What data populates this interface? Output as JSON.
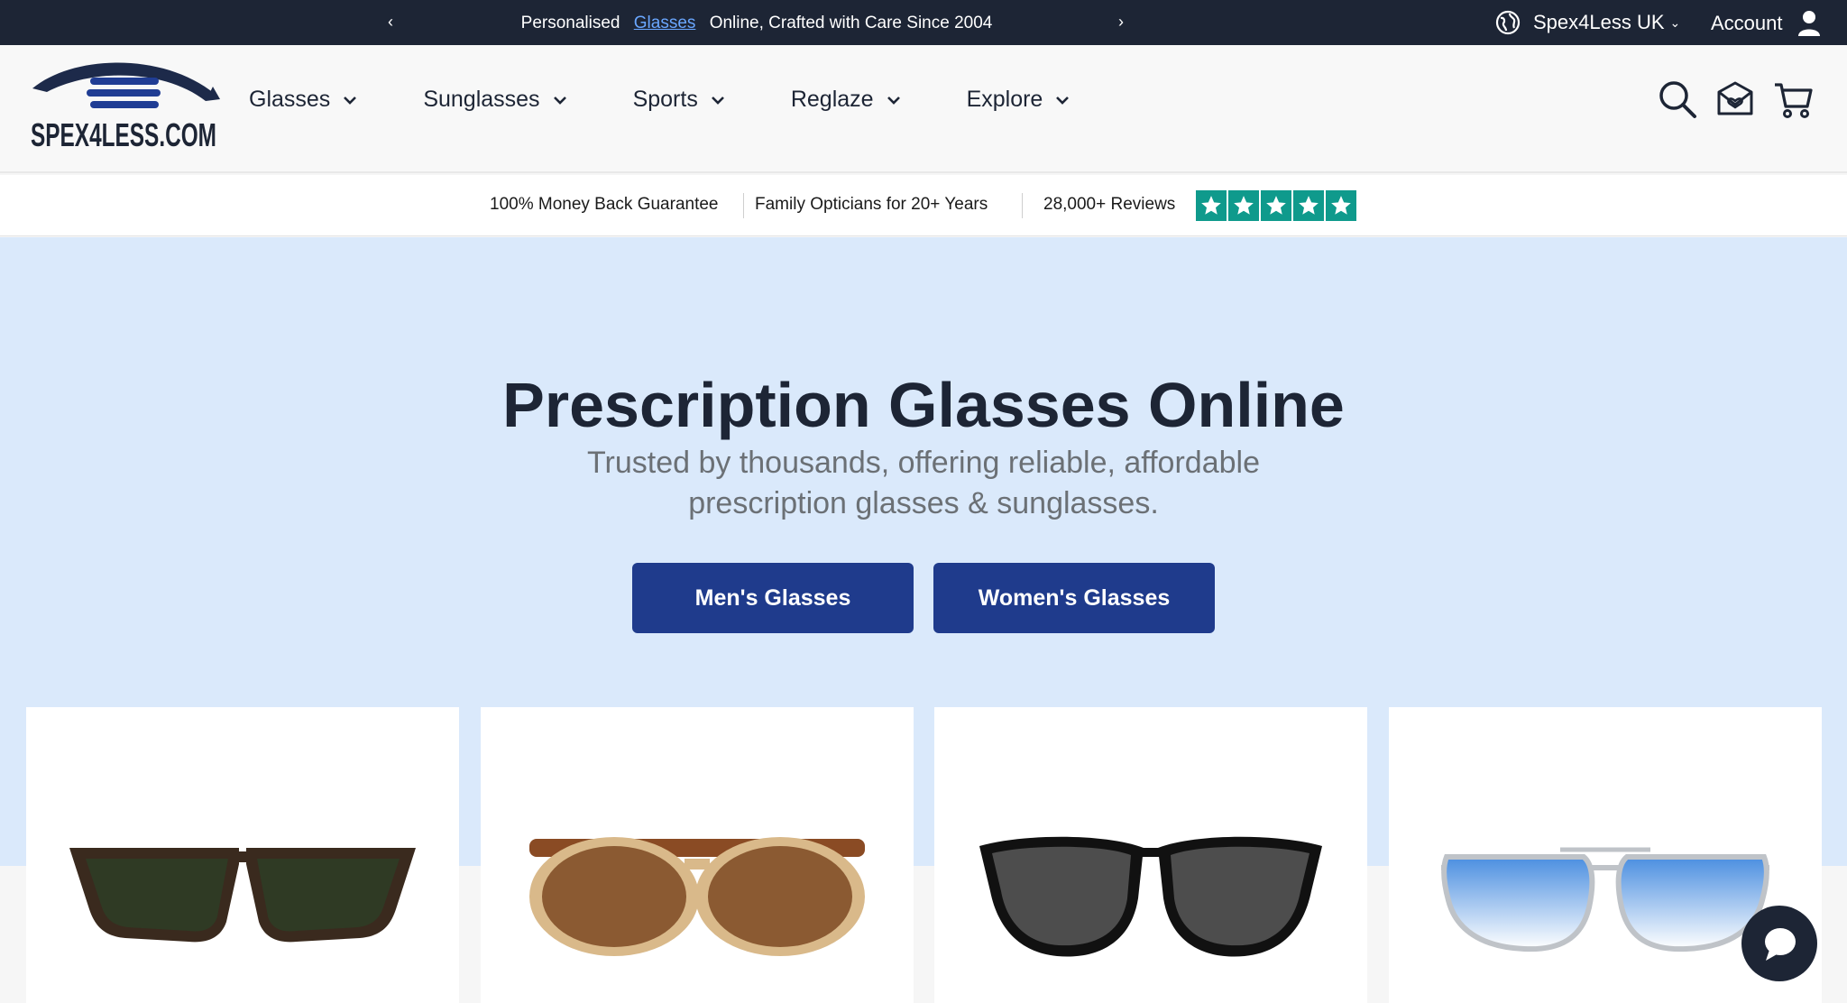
{
  "announcement": {
    "prefix": "Personalised",
    "link": "Glasses",
    "suffix": "Online, Crafted with Care Since 2004",
    "prev_arrow": "‹",
    "next_arrow": "›"
  },
  "topbar": {
    "region": "Spex4Less UK",
    "account": "Account"
  },
  "logo": {
    "text": "SPEX4LESS.COM"
  },
  "nav": {
    "items": [
      {
        "label": "Glasses"
      },
      {
        "label": "Sunglasses"
      },
      {
        "label": "Sports"
      },
      {
        "label": "Reglaze"
      },
      {
        "label": "Explore"
      }
    ]
  },
  "icons": {
    "search": "search-icon",
    "contact": "mail-heart-icon",
    "cart": "cart-icon",
    "globe": "globe-icon",
    "user": "user-icon",
    "chat": "chat-bubble-icon"
  },
  "trust": {
    "guarantee": "100% Money Back Guarantee",
    "opticians": "Family Opticians for 20+ Years",
    "reviews": "28,000+ Reviews",
    "star_rating": 5
  },
  "hero": {
    "title": "Prescription Glasses Online",
    "subtitle_line1": "Trusted by thousands, offering reliable, affordable",
    "subtitle_line2": "prescription glasses & sunglasses.",
    "men_button": "Men's Glasses",
    "women_button": "Women's Glasses"
  },
  "products": [
    {
      "name": "tortoise-wayfarer-sunglasses",
      "frame_color": "#3a2a1e",
      "lens_color": "#2f3a24"
    },
    {
      "name": "round-brown-sunglasses",
      "frame_color": "#d9b98a",
      "lens_color": "#8b5a32"
    },
    {
      "name": "black-cateye-sunglasses",
      "frame_color": "#111111",
      "lens_color": "#4d4d4d"
    },
    {
      "name": "silver-aviator-sunglasses",
      "frame_color": "#bfc3c8",
      "lens_color": "#4a8ee0"
    }
  ],
  "colors": {
    "topbar_bg": "#1d2535",
    "hero_bg": "#dae9fb",
    "button_bg": "#1f3b8c",
    "star_bg": "#0f9a8c",
    "link": "#6aa7ff"
  }
}
